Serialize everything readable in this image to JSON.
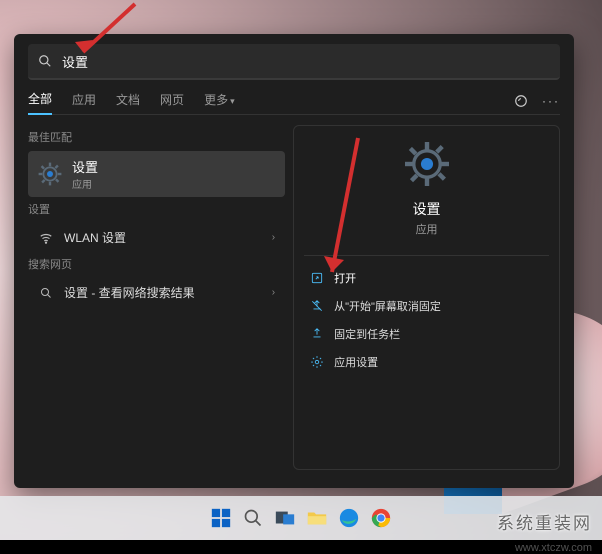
{
  "search": {
    "value": "设置"
  },
  "tabs": {
    "items": [
      "全部",
      "应用",
      "文档",
      "网页",
      "更多"
    ],
    "active": 0
  },
  "left": {
    "best_match_label": "最佳匹配",
    "best": {
      "title": "设置",
      "subtitle": "应用"
    },
    "settings_label": "设置",
    "wlan": "WLAN 设置",
    "web_label": "搜索网页",
    "web_item": "设置 - 查看网络搜索结果"
  },
  "detail": {
    "title": "设置",
    "subtitle": "应用",
    "actions": {
      "open": "打开",
      "unpin": "从\"开始\"屏幕取消固定",
      "pin_tb": "固定到任务栏",
      "app_settings": "应用设置"
    }
  },
  "watermark": {
    "text": "系统重装网",
    "url": "www.xtczw.com"
  }
}
